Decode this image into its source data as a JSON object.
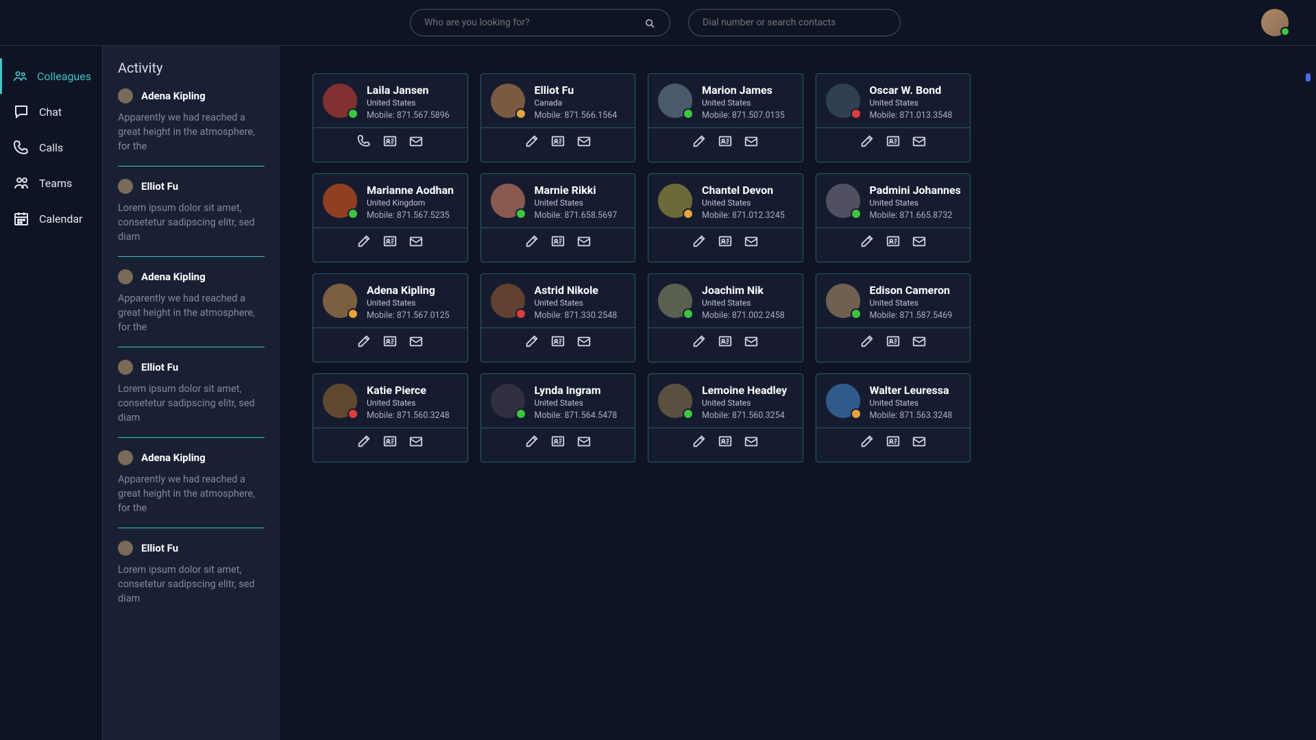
{
  "search": {
    "placeholder1": "Who are you looking for?",
    "placeholder2": "Dial number or search contacts"
  },
  "nav": {
    "items": [
      {
        "label": "Colleagues",
        "active": true
      },
      {
        "label": "Chat",
        "active": false
      },
      {
        "label": "Calls",
        "active": false
      },
      {
        "label": "Teams",
        "active": false
      },
      {
        "label": "Calendar",
        "active": false
      }
    ]
  },
  "activity": {
    "title": "Activity",
    "items": [
      {
        "name": "Adena Kipling",
        "msg": "Apparently we had reached a great height in the atmosphere, for the"
      },
      {
        "name": "Elliot Fu",
        "msg": "Lorem ipsum dolor sit amet, consetetur sadipscing elitr, sed diam"
      },
      {
        "name": "Adena Kipling",
        "msg": "Apparently we had reached a great height in the atmosphere, for the"
      },
      {
        "name": "Elliot Fu",
        "msg": "Lorem ipsum dolor sit amet, consetetur sadipscing elitr, sed diam"
      },
      {
        "name": "Adena Kipling",
        "msg": "Apparently we had reached a great height in the atmosphere, for the"
      },
      {
        "name": "Elliot Fu",
        "msg": "Lorem ipsum dolor sit amet, consetetur sadipscing elitr, sed diam"
      }
    ]
  },
  "mobile_label": "Mobile: ",
  "contacts": [
    {
      "name": "Laila Jansen",
      "loc": "United States",
      "phone": "871.567.5896",
      "status": "g",
      "first_icon": "phone"
    },
    {
      "name": "Elliot Fu",
      "loc": "Canada",
      "phone": "871.566.1564",
      "status": "o",
      "first_icon": "edit"
    },
    {
      "name": "Marion James",
      "loc": "United States",
      "phone": "871.507.0135",
      "status": "g",
      "first_icon": "edit"
    },
    {
      "name": "Oscar W. Bond",
      "loc": "United States",
      "phone": "871.013.3548",
      "status": "r",
      "first_icon": "edit"
    },
    {
      "name": "Marianne Aodhan",
      "loc": "United Kingdom",
      "phone": "871.567.5235",
      "status": "g",
      "first_icon": "edit"
    },
    {
      "name": "Marnie Rikki",
      "loc": "United States",
      "phone": "871.658.5697",
      "status": "g",
      "first_icon": "edit"
    },
    {
      "name": "Chantel Devon",
      "loc": "United States",
      "phone": "871.012.3245",
      "status": "o",
      "first_icon": "edit"
    },
    {
      "name": "Padmini Johannes",
      "loc": "United States",
      "phone": "871.665.8732",
      "status": "g",
      "first_icon": "edit"
    },
    {
      "name": "Adena Kipling",
      "loc": "United States",
      "phone": "871.567.0125",
      "status": "o",
      "first_icon": "edit"
    },
    {
      "name": "Astrid Nikole",
      "loc": "United States",
      "phone": "871.330.2548",
      "status": "r",
      "first_icon": "edit"
    },
    {
      "name": "Joachim Nik",
      "loc": "United States",
      "phone": "871.002.2458",
      "status": "g",
      "first_icon": "edit"
    },
    {
      "name": "Edison Cameron",
      "loc": "United States",
      "phone": "871.587.5469",
      "status": "g",
      "first_icon": "edit"
    },
    {
      "name": "Katie Pierce",
      "loc": "United States",
      "phone": "871.560.3248",
      "status": "r",
      "first_icon": "edit"
    },
    {
      "name": "Lynda Ingram",
      "loc": "United States",
      "phone": "871.564.5478",
      "status": "g",
      "first_icon": "edit"
    },
    {
      "name": "Lemoine Headley",
      "loc": "United States",
      "phone": "871.560.3254",
      "status": "g",
      "first_icon": "edit"
    },
    {
      "name": "Walter Leuressa",
      "loc": "United States",
      "phone": "871.563.3248",
      "status": "o",
      "first_icon": "edit"
    }
  ]
}
